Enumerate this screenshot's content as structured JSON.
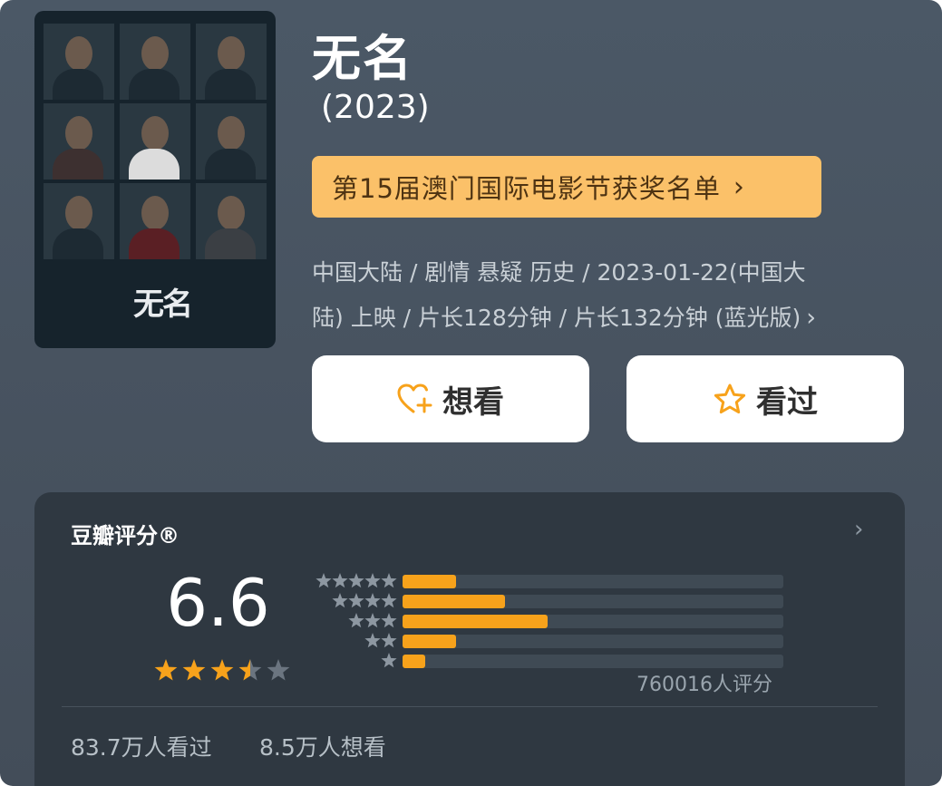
{
  "movie": {
    "poster_title": "无名",
    "title": "无名",
    "year": "(2023)",
    "award_label": "第15届澳门国际电影节获奖名单",
    "meta_line1": "中国大陆 / 剧情 悬疑 历史 / 2023-01-22(中国大",
    "meta_line2": "陆) 上映 / 片长128分钟 / 片长132分钟 (蓝光版)"
  },
  "actions": {
    "want_label": "想看",
    "seen_label": "看过"
  },
  "rating": {
    "title": "豆瓣评分®",
    "score": "6.6",
    "stars_value": 3.5,
    "votes_label": "760016人评分",
    "distribution": [
      {
        "stars": 5,
        "fraction": 0.14
      },
      {
        "stars": 4,
        "fraction": 0.27
      },
      {
        "stars": 3,
        "fraction": 0.38
      },
      {
        "stars": 2,
        "fraction": 0.14
      },
      {
        "stars": 1,
        "fraction": 0.06
      }
    ],
    "seen_count": "83.7万人看过",
    "want_count": "8.5万人想看"
  },
  "colors": {
    "accent": "#f7a21b",
    "award_bg": "#fbc169",
    "background": "#47525f",
    "card": "#2f3841"
  },
  "icons": {
    "want": "heart-plus-icon",
    "seen": "star-outline-icon"
  }
}
